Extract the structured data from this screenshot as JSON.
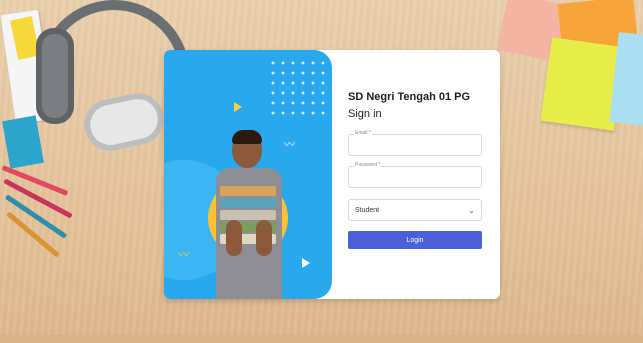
{
  "login": {
    "school_name": "SD Negri Tengah 01 PG",
    "heading": "Sign in",
    "email_label": "Email *",
    "email_value": "",
    "password_label": "Password *",
    "password_value": "",
    "role_selected": "Student",
    "submit_label": "Login"
  },
  "colors": {
    "hero_bg": "#29a8ee",
    "accent_yellow": "#ffc233",
    "button": "#4b5fd6"
  },
  "icons": {
    "select_chevron": "chevron-down-icon"
  }
}
